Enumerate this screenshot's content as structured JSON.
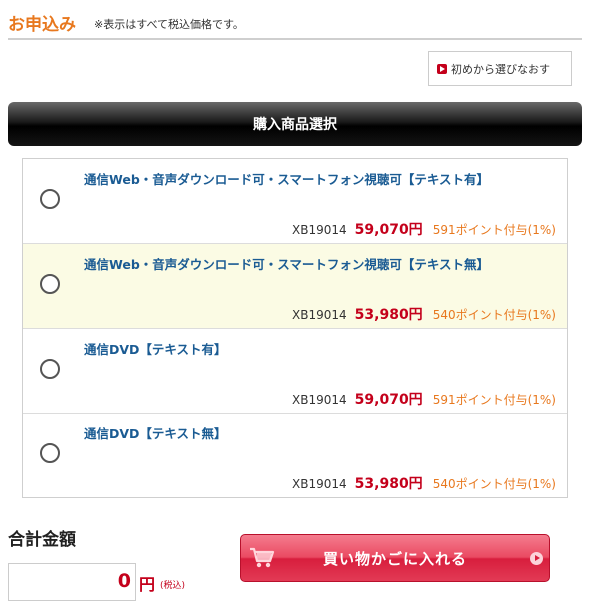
{
  "header": {
    "title": "お申込み",
    "note": "※表示はすべて税込価格です。"
  },
  "restart_button": {
    "label": "初めから選びなおす",
    "icon": "play-arrow-icon"
  },
  "section": {
    "title": "購入商品選択"
  },
  "products": [
    {
      "name": "通信Web・音声ダウンロード可・スマートフォン視聴可【テキスト有】",
      "code": "XB19014",
      "price": "59,070円",
      "points": "591ポイント付与(1%)",
      "selected": false
    },
    {
      "name": "通信Web・音声ダウンロード可・スマートフォン視聴可【テキスト無】",
      "code": "XB19014",
      "price": "53,980円",
      "points": "540ポイント付与(1%)",
      "selected": false
    },
    {
      "name": "通信DVD【テキスト有】",
      "code": "XB19014",
      "price": "59,070円",
      "points": "591ポイント付与(1%)",
      "selected": false
    },
    {
      "name": "通信DVD【テキスト無】",
      "code": "XB19014",
      "price": "53,980円",
      "points": "540ポイント付与(1%)",
      "selected": false
    }
  ],
  "total": {
    "label": "合計金額",
    "amount": "0",
    "currency": "円",
    "tax_note": "(税込)"
  },
  "cart_button": {
    "label": "買い物かごに入れる",
    "icon": "shopping-cart-icon"
  },
  "colors": {
    "accent_orange": "#e8781e",
    "price_red": "#c4001b",
    "link_blue": "#1a5b93",
    "highlight_row": "#fbfbe4"
  }
}
